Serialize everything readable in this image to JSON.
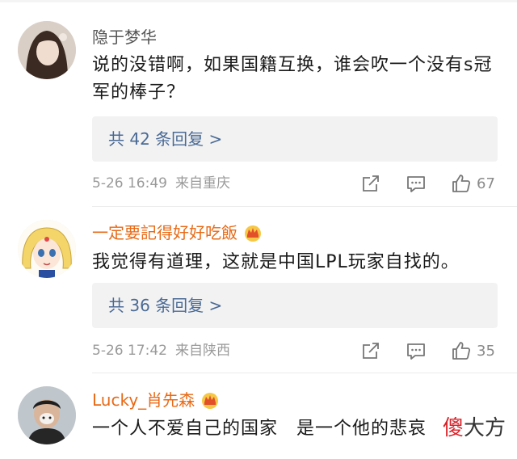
{
  "comments": [
    {
      "username": "隐于梦华",
      "text": "说的没错啊，如果国籍互换，谁会吹一个没有s冠军的棒子？",
      "replies": "共 42 条回复 >",
      "time": "5-26 16:49",
      "source": "来自重庆",
      "likes": "67"
    },
    {
      "username": "一定要記得好好吃飯",
      "text": "我觉得有道理，这就是中国LPL玩家自找的。",
      "replies": "共 36 条回复 >",
      "time": "5-26 17:42",
      "source": "来自陕西",
      "likes": "35"
    },
    {
      "username": "Lucky_肖先森",
      "text": "一个人不爱自己的国家　是一个他的悲哀"
    }
  ],
  "watermark": {
    "red": "傻",
    "black": "大方"
  },
  "colors": {
    "vip_name": "#e86a16",
    "reply_link": "#4a6a95",
    "meta": "#9a9a9a"
  },
  "icons": [
    "share-icon",
    "comment-icon",
    "like-icon",
    "crown-icon"
  ]
}
